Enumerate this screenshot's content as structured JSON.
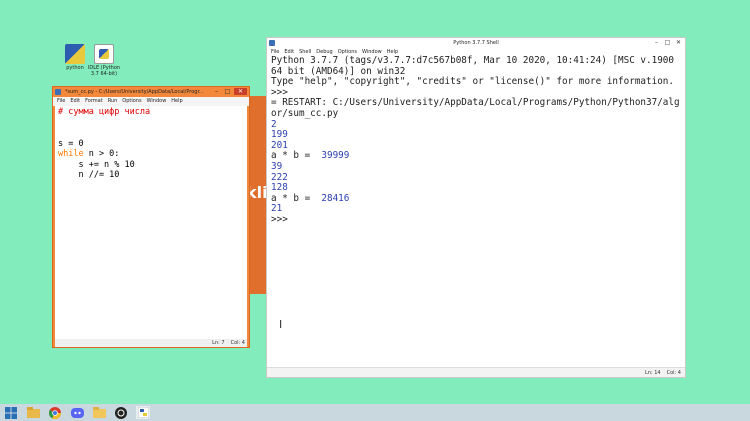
{
  "desktop": {
    "icons": [
      {
        "label": "python",
        "icon": "python-shortcut-icon"
      },
      {
        "label": "IDLE (Python 3.7 64-bit)",
        "icon": "idle-shortcut-icon"
      }
    ]
  },
  "editor": {
    "title": "*sum_cc.py - C:/Users/University/AppData/Local/Progr...",
    "menu": [
      "File",
      "Edit",
      "Format",
      "Run",
      "Options",
      "Window",
      "Help"
    ],
    "code": {
      "l1": "# сумма цифр числа",
      "l2": "",
      "l3": "",
      "l4": "s = 0",
      "l5_kw": "while",
      "l5_rest": " n > 0:",
      "l6": "    s += n % 10",
      "l7": "    n //= 10"
    },
    "status": {
      "ln": "Ln: 7",
      "col": "Col: 4"
    }
  },
  "shell": {
    "title": "Python 3.7.7 Shell",
    "menu": [
      "File",
      "Edit",
      "Shell",
      "Debug",
      "Options",
      "Window",
      "Help"
    ],
    "lines": {
      "l1": "Python 3.7.7 (tags/v3.7.7:d7c567b08f, Mar 10 2020, 10:41:24) [MSC v.1900",
      "l2": "64 bit (AMD64)] on win32",
      "l3": "Type \"help\", \"copyright\", \"credits\" or \"license()\" for more information.",
      "l4": ">>>",
      "l5": "= RESTART: C:/Users/University/AppData/Local/Programs/Python/Python37/alg",
      "l6": "or/sum_cc.py",
      "l7": "2",
      "l8": "199",
      "l9": "201",
      "l10a": "a * b =  ",
      "l10b": "39999",
      "l11": "39",
      "l12": "222",
      "l13": "128",
      "l14a": "a * b =  ",
      "l14b": "28416",
      "l15": "21",
      "l16": ">>>"
    },
    "status": {
      "ln": "Ln: 14",
      "col": "Col: 4"
    }
  },
  "background_text": "kli",
  "taskbar": {
    "icons": [
      "windows-start-icon",
      "file-explorer-icon",
      "chrome-icon",
      "discord-icon",
      "folder-icon",
      "obs-icon",
      "python-idle-icon"
    ]
  },
  "colors": {
    "desktop": "#82ecbd",
    "accent_orange": "#e06f2e",
    "python_blue": "#2b3faf"
  }
}
